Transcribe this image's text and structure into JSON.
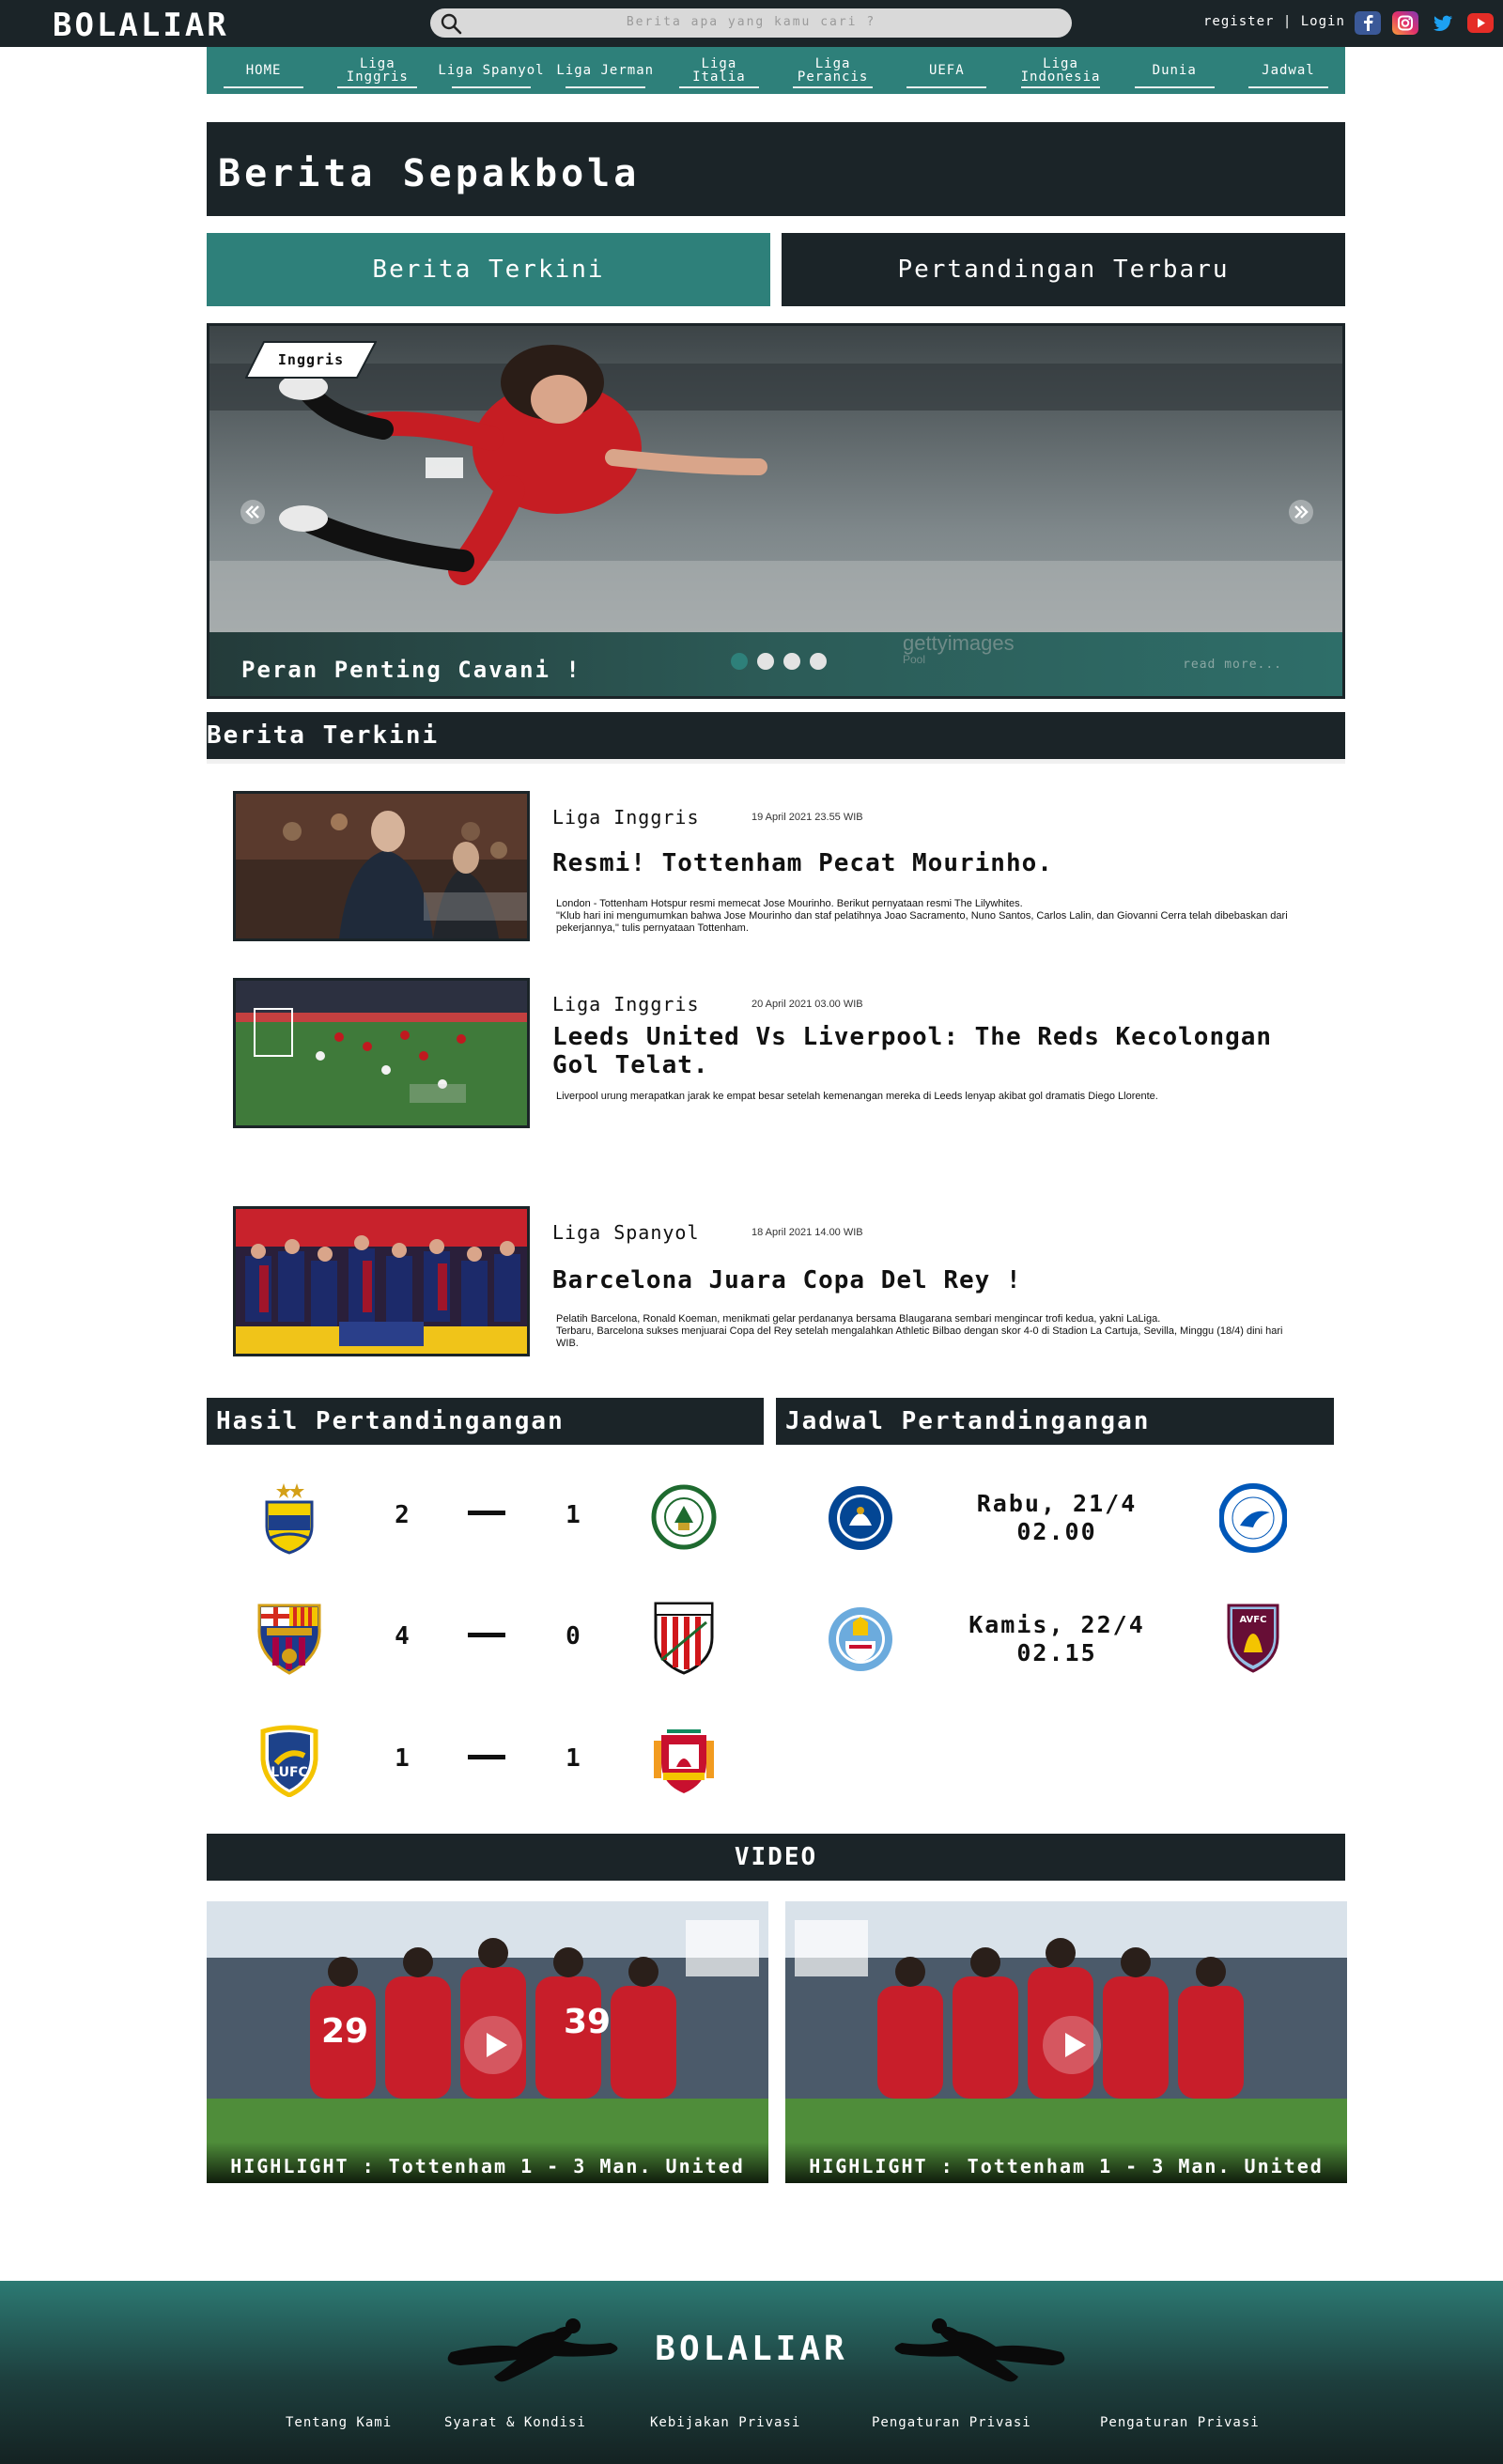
{
  "header": {
    "logo": "BOLALIAR",
    "search_placeholder": "Berita apa yang kamu cari ?",
    "register": "register",
    "separator": "|",
    "login": "Login",
    "socials": [
      "facebook-icon",
      "instagram-icon",
      "twitter-icon",
      "youtube-icon"
    ],
    "colors": {
      "dark": "#1b2428",
      "teal": "#2e807a"
    }
  },
  "nav": {
    "items": [
      "HOME",
      "Liga\nInggris",
      "Liga Spanyol",
      "Liga Jerman",
      "Liga\nItalia",
      "Liga Perancis",
      "UEFA",
      "Liga\nIndonesia",
      "Dunia",
      "Jadwal"
    ]
  },
  "hero": {
    "title": "Berita Sepakbola",
    "tab_left": "Berita Terkini",
    "tab_right": "Pertandingan Terbaru"
  },
  "carousel": {
    "badge": "Inggris",
    "caption": "Peran Penting Cavani !",
    "read_more": "read more...",
    "watermark": "gettyimages",
    "watermark_sub": "Pool",
    "dots": 4,
    "active_dot": 0
  },
  "news_section": {
    "title": "Berita Terkini",
    "items": [
      {
        "category": "Liga Inggris",
        "date": "19 April 2021    23.55 WIB",
        "title": "Resmi! Tottenham Pecat Mourinho.",
        "body": "London - Tottenham Hotspur resmi memecat Jose Mourinho. Berikut pernyataan resmi The Lilywhites.\n\"Klub hari ini mengumumkan bahwa Jose Mourinho dan staf pelatihnya Joao Sacramento, Nuno Santos, Carlos Lalin, dan Giovanni Cerra telah dibebaskan dari pekerjannya,\" tulis pernyataan Tottenham."
      },
      {
        "category": "Liga Inggris",
        "date": "20 April 2021    03.00 WIB",
        "title": "Leeds United Vs Liverpool: The Reds Kecolongan Gol Telat.",
        "body": "Liverpool urung merapatkan jarak ke empat besar setelah kemenangan mereka di Leeds lenyap akibat gol dramatis Diego Llorente."
      },
      {
        "category": "Liga Spanyol",
        "date": "18 April 2021    14.00 WIB",
        "title": "Barcelona Juara Copa Del Rey !",
        "body": "Pelatih Barcelona, Ronald Koeman, menikmati gelar perdananya bersama Blaugarana sembari mengincar trofi kedua, yakni LaLiga.\nTerbaru, Barcelona sukses menjuarai Copa del Rey setelah mengalahkan Athletic Bilbao dengan skor 4-0 di Stadion La Cartuja, Sevilla, Minggu (18/4) dini hari WIB."
      }
    ]
  },
  "results": {
    "title": "Hasil Pertandingangan",
    "matches": [
      {
        "home": "persis-crest",
        "home_score": "2",
        "away_score": "1",
        "away": "pss-crest"
      },
      {
        "home": "barcelona-crest",
        "home_score": "4",
        "away_score": "0",
        "away": "athletic-crest"
      },
      {
        "home": "leeds-crest",
        "home_score": "1",
        "away_score": "1",
        "away": "liverpool-crest"
      }
    ]
  },
  "schedule": {
    "title": "Jadwal Pertandingangan",
    "matches": [
      {
        "home": "chelsea-crest",
        "time": "Rabu, 21/4\n02.00",
        "away": "brighton-crest"
      },
      {
        "home": "man-city-crest",
        "time": "Kamis, 22/4\n02.15",
        "away": "aston-villa-crest"
      }
    ]
  },
  "video": {
    "title": "VIDEO",
    "items": [
      {
        "caption": "HIGHLIGHT : Tottenham 1 - 3 Man. United"
      },
      {
        "caption": "HIGHLIGHT : Tottenham 1 - 3 Man. United"
      }
    ]
  },
  "footer": {
    "logo": "BOLALIAR",
    "links": [
      "Tentang Kami",
      "Syarat & Kondisi",
      "Kebijakan Privasi",
      "Pengaturan Privasi",
      "Pengaturan Privasi"
    ]
  }
}
